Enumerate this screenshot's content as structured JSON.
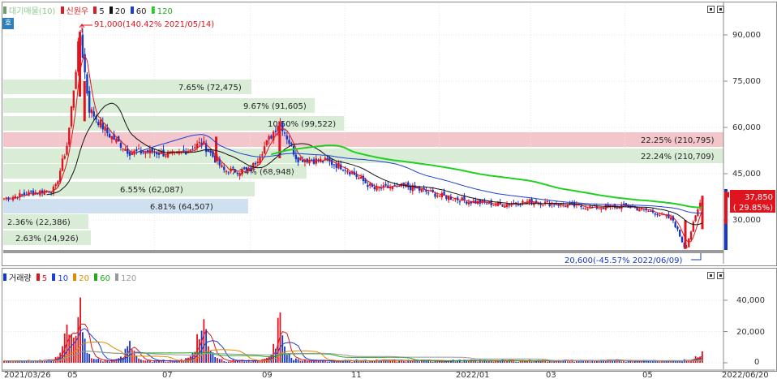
{
  "price_panel": {
    "legend": [
      {
        "label": "대기매물(10)",
        "color": "#8fc78f",
        "marker": "#6aa06a"
      },
      {
        "label": "신원우",
        "color": "#d62020",
        "marker": "#d62020"
      },
      {
        "label": "5",
        "color": "#000000",
        "marker": "#d62020"
      },
      {
        "label": "20",
        "color": "#000000",
        "marker": "#111111"
      },
      {
        "label": "60",
        "color": "#1a3fd1",
        "marker": "#1a3fd1"
      },
      {
        "label": "120",
        "color": "#1faa1f",
        "marker": "#22cc22"
      }
    ],
    "side_tab": "호",
    "y_ticks": [
      "90,000",
      "75,000",
      "60,000",
      "45,000",
      "30,000"
    ],
    "max_annotation": "91,000(140.42% 2021/05/14)",
    "min_annotation": "20,600(-45.57% 2022/06/09)",
    "current_price": "37,850",
    "current_change": "( 29.85%)",
    "volume_profile": [
      {
        "label": "7.65% (72,475)",
        "color": "#d8ecd6"
      },
      {
        "label": "9.67% (91,605)",
        "color": "#d8ecd6"
      },
      {
        "label": "10.50% (99,522)",
        "color": "#d8ecd6"
      },
      {
        "label": "22.25% (210,795)",
        "color": "#f2c6cb"
      },
      {
        "label": "22.24% (210,709)",
        "color": "#d8ecd6"
      },
      {
        "label": "7.34% (68,948)",
        "color": "#d8ecd6"
      },
      {
        "label": "6.55% (62,087)",
        "color": "#d8ecd6"
      },
      {
        "label": "6.81% (64,507)",
        "color": "#cfe0f0"
      },
      {
        "label": "2.36% (22,386)",
        "color": "#d8ecd6"
      },
      {
        "label": "2.63% (24,926)",
        "color": "#d8ecd6"
      }
    ],
    "colors": {
      "up": "#e0141e",
      "down": "#1537c8",
      "ma5": "#e0141e",
      "ma20": "#111111",
      "ma60": "#1a3fd1",
      "ma120": "#22d022"
    }
  },
  "volume_panel": {
    "legend": [
      {
        "label": "거래량",
        "color": "#000000",
        "marker": "#1537c8"
      },
      {
        "label": "5",
        "color": "#e0141e",
        "marker": "#e0141e"
      },
      {
        "label": "10",
        "color": "#1a3fd1",
        "marker": "#1a3fd1"
      },
      {
        "label": "20",
        "color": "#e08a00",
        "marker": "#e08a00"
      },
      {
        "label": "60",
        "color": "#1faa1f",
        "marker": "#1faa1f"
      },
      {
        "label": "120",
        "color": "#999999",
        "marker": "#999999"
      }
    ],
    "y_ticks": [
      "40,000",
      "20,000",
      "0"
    ]
  },
  "x_axis": {
    "ticks": [
      "2021/03/26",
      "05",
      "07",
      "09",
      "11",
      "2022/01",
      "03",
      "05",
      "2022/06/20"
    ]
  },
  "chart_data": {
    "type": "candlestick",
    "x_range": [
      "2021/03/26",
      "2022/06/20"
    ],
    "y_range": [
      20600,
      91000
    ],
    "max": {
      "price": 91000,
      "change_pct": 140.42,
      "date": "2021/05/14"
    },
    "min": {
      "price": 20600,
      "change_pct": -45.57,
      "date": "2022/06/09"
    },
    "last": {
      "price": 37850,
      "change_pct": 29.85
    },
    "close_path": [
      [
        "2021/03/26",
        37000
      ],
      [
        "2021/04/10",
        38500
      ],
      [
        "2021/04/28",
        40000
      ],
      [
        "2021/05/06",
        55000
      ],
      [
        "2021/05/14",
        91000
      ],
      [
        "2021/05/20",
        66000
      ],
      [
        "2021/06/01",
        58000
      ],
      [
        "2021/06/15",
        52000
      ],
      [
        "2021/07/01",
        52000
      ],
      [
        "2021/07/15",
        51000
      ],
      [
        "2021/08/01",
        55000
      ],
      [
        "2021/08/15",
        46000
      ],
      [
        "2021/09/01",
        46000
      ],
      [
        "2021/09/20",
        62000
      ],
      [
        "2021/10/01",
        50000
      ],
      [
        "2021/10/20",
        49000
      ],
      [
        "2021/11/01",
        47000
      ],
      [
        "2021/11/20",
        40000
      ],
      [
        "2021/12/10",
        41000
      ],
      [
        "2022/01/01",
        38000
      ],
      [
        "2022/01/20",
        36000
      ],
      [
        "2022/02/10",
        35000
      ],
      [
        "2022/03/01",
        36000
      ],
      [
        "2022/03/20",
        35000
      ],
      [
        "2022/04/10",
        34000
      ],
      [
        "2022/05/01",
        34500
      ],
      [
        "2022/05/20",
        32500
      ],
      [
        "2022/06/01",
        30000
      ],
      [
        "2022/06/09",
        20600
      ],
      [
        "2022/06/20",
        37850
      ]
    ],
    "volume_peaks": [
      [
        "2021/05/06",
        40000
      ],
      [
        "2021/05/14",
        52000
      ],
      [
        "2021/06/15",
        20000
      ],
      [
        "2021/08/01",
        50000
      ],
      [
        "2021/09/20",
        40000
      ],
      [
        "2022/06/20",
        10000
      ]
    ]
  }
}
